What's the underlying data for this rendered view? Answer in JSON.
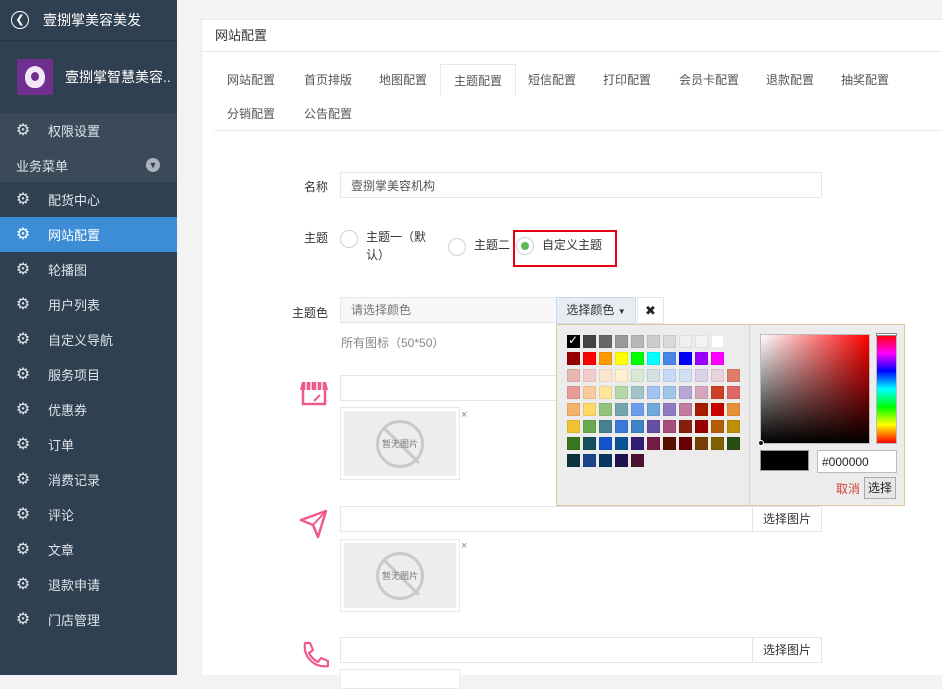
{
  "sidebar": {
    "top_title": "壹捌掌美容美发",
    "brand_name": "壹捌掌智慧美容...",
    "first_item": "权限设置",
    "section_label": "业务菜单",
    "items": [
      "配货中心",
      "网站配置",
      "轮播图",
      "用户列表",
      "自定义导航",
      "服务项目",
      "优惠券",
      "订单",
      "消费记录",
      "评论",
      "文章",
      "退款申请",
      "门店管理"
    ]
  },
  "panel": {
    "title": "网站配置",
    "tabs": [
      "网站配置",
      "首页排版",
      "地图配置",
      "主题配置",
      "短信配置",
      "打印配置",
      "会员卡配置",
      "退款配置",
      "抽奖配置",
      "分销配置",
      "公告配置"
    ],
    "active_tab": "主题配置"
  },
  "form": {
    "name_label": "名称",
    "name_value": "壹捌掌美容机构",
    "theme_label": "主题",
    "theme_options": [
      "主题一（默认）",
      "主题二",
      "自定义主题"
    ],
    "theme_selected": "自定义主题",
    "color_label": "主题色",
    "color_placeholder": "请选择颜色",
    "color_button": "选择颜色",
    "clear_button": "✖",
    "icons_hint": "所有图标（50*50）",
    "no_image_text": "暂无图片",
    "select_image_button": "选择图片",
    "remove_mark": "×"
  },
  "colorpicker": {
    "hex_value": "#000000",
    "cancel_label": "取消",
    "choose_label": "选择",
    "selected_color": "#000000",
    "swatch_rows": [
      [
        "#000000",
        "#444444",
        "#666666",
        "#999999",
        "#b7b7b7",
        "#cccccc",
        "#d9d9d9",
        "#efefef",
        "#f3f3f3",
        "#ffffff"
      ],
      [
        "#980000",
        "#ff0000",
        "#ff9900",
        "#ffff00",
        "#00ff00",
        "#00ffff",
        "#4a86e8",
        "#0000ff",
        "#9900ff",
        "#ff00ff"
      ],
      [
        "#e6b8af",
        "#f4cccc",
        "#fce5cd",
        "#fff2cc",
        "#d9ead3",
        "#d0e0e3",
        "#c9daf8",
        "#cfe2f3",
        "#d9d2e9",
        "#ead1dc",
        "#dd7e6b"
      ],
      [
        "#ea9999",
        "#f9cb9c",
        "#ffe599",
        "#b6d7a8",
        "#a2c4c9",
        "#a4c2f4",
        "#9fc5e8",
        "#b4a7d6",
        "#d5a6bd",
        "#cc4125",
        "#e06666"
      ],
      [
        "#f6b26b",
        "#ffd966",
        "#93c47d",
        "#76a5af",
        "#6d9eeb",
        "#6fa8dc",
        "#8e7cc3",
        "#c27ba0",
        "#a61c00",
        "#cc0000",
        "#e69138"
      ],
      [
        "#f1c232",
        "#6aa84f",
        "#45818e",
        "#3c78d8",
        "#3d85c6",
        "#674ea7",
        "#a64d79",
        "#85200c",
        "#990000",
        "#b45f06",
        "#bf9000"
      ],
      [
        "#38761d",
        "#134f5c",
        "#1155cc",
        "#0b5394",
        "#351c75",
        "#741b47",
        "#5b0f00",
        "#660000",
        "#783f04",
        "#7f6000",
        "#274e13"
      ],
      [
        "#0c343d",
        "#1c4587",
        "#073763",
        "#20124d",
        "#4c1130"
      ]
    ]
  },
  "icons": [
    "shop-icon",
    "send-arrow-icon",
    "phone-icon"
  ],
  "colors": {
    "sidebar_bg": "#2f4050",
    "active_item": "#3c8dd5",
    "icon_pink": "#ee5a8f",
    "highlight_border": "#e60012"
  }
}
